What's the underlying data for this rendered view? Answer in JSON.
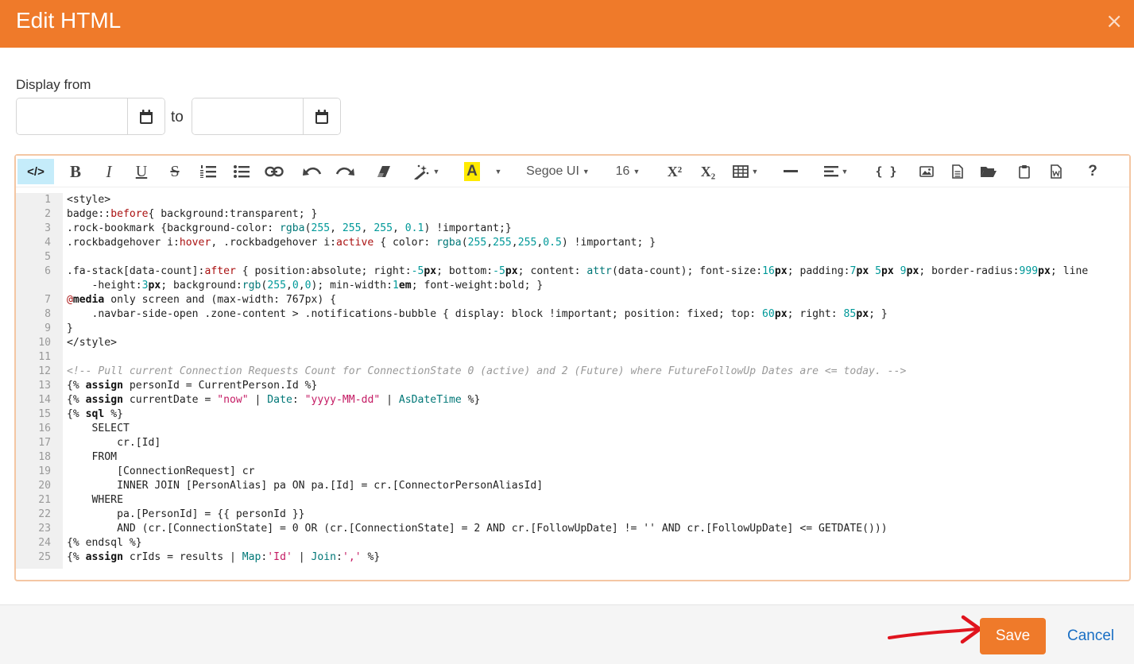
{
  "dialog": {
    "title": "Edit HTML",
    "close_glyph": "×"
  },
  "display_range": {
    "label": "Display from",
    "start_value": "",
    "to_label": "to",
    "end_value": ""
  },
  "toolbar": {
    "font_name": "Segoe UI",
    "font_size": "16",
    "code_view_glyph": "</>",
    "bold_glyph": "B",
    "italic_glyph": "I",
    "underline_glyph": "U",
    "strike_glyph": "S",
    "highlight_glyph": "A",
    "superscript_glyph": "X²",
    "subscript_glyph": "X₂",
    "braces_glyph": "{ }",
    "help_glyph": "?"
  },
  "code_lines": [
    {
      "n": "1"
    },
    {
      "n": "2"
    },
    {
      "n": "3"
    },
    {
      "n": "4"
    },
    {
      "n": "5"
    },
    {
      "n": "6"
    },
    {
      "n": ""
    },
    {
      "n": "7"
    },
    {
      "n": "8"
    },
    {
      "n": "9"
    },
    {
      "n": "10"
    },
    {
      "n": "11"
    },
    {
      "n": "12"
    },
    {
      "n": "13"
    },
    {
      "n": "14"
    },
    {
      "n": "15"
    },
    {
      "n": "16"
    },
    {
      "n": "17"
    },
    {
      "n": "18"
    },
    {
      "n": "19"
    },
    {
      "n": "20"
    },
    {
      "n": "21"
    },
    {
      "n": "22"
    },
    {
      "n": "23"
    },
    {
      "n": "24"
    },
    {
      "n": "25"
    }
  ],
  "code_segments": [
    [
      [
        "t",
        "<style>"
      ]
    ],
    [
      [
        "t",
        "badge::"
      ],
      [
        "k",
        "before"
      ],
      [
        "t",
        "{ background:transparent; }"
      ]
    ],
    [
      [
        "t",
        ".rock-bookmark {background-color: "
      ],
      [
        "f",
        "rgba"
      ],
      [
        "t",
        "("
      ],
      [
        "d",
        "255"
      ],
      [
        "t",
        ", "
      ],
      [
        "d",
        "255"
      ],
      [
        "t",
        ", "
      ],
      [
        "d",
        "255"
      ],
      [
        "t",
        ", "
      ],
      [
        "d",
        "0.1"
      ],
      [
        "t",
        ") !important;}"
      ]
    ],
    [
      [
        "t",
        ".rockbadgehover i:"
      ],
      [
        "k",
        "hover"
      ],
      [
        "t",
        ", .rockbadgehover i:"
      ],
      [
        "k",
        "active"
      ],
      [
        "t",
        " { color: "
      ],
      [
        "f",
        "rgba"
      ],
      [
        "t",
        "("
      ],
      [
        "d",
        "255"
      ],
      [
        "t",
        ","
      ],
      [
        "d",
        "255"
      ],
      [
        "t",
        ","
      ],
      [
        "d",
        "255"
      ],
      [
        "t",
        ","
      ],
      [
        "d",
        "0.5"
      ],
      [
        "t",
        ") !important; }"
      ]
    ],
    [
      [
        "t",
        ""
      ]
    ],
    [
      [
        "t",
        ".fa-stack[data-count]:"
      ],
      [
        "k",
        "after"
      ],
      [
        "t",
        " { position:absolute; right:"
      ],
      [
        "d",
        "-5"
      ],
      [
        "b",
        "px"
      ],
      [
        "t",
        "; bottom:"
      ],
      [
        "d",
        "-5"
      ],
      [
        "b",
        "px"
      ],
      [
        "t",
        "; content: "
      ],
      [
        "f",
        "attr"
      ],
      [
        "t",
        "(data-count); font-size:"
      ],
      [
        "d",
        "16"
      ],
      [
        "b",
        "px"
      ],
      [
        "t",
        "; padding:"
      ],
      [
        "d",
        "7"
      ],
      [
        "b",
        "px"
      ],
      [
        "t",
        " "
      ],
      [
        "d",
        "5"
      ],
      [
        "b",
        "px"
      ],
      [
        "t",
        " "
      ],
      [
        "d",
        "9"
      ],
      [
        "b",
        "px"
      ],
      [
        "t",
        "; border-radius:"
      ],
      [
        "d",
        "999"
      ],
      [
        "b",
        "px"
      ],
      [
        "t",
        "; line"
      ]
    ],
    [
      [
        "t",
        "    -height:"
      ],
      [
        "d",
        "3"
      ],
      [
        "b",
        "px"
      ],
      [
        "t",
        "; background:"
      ],
      [
        "f",
        "rgb"
      ],
      [
        "t",
        "("
      ],
      [
        "d",
        "255"
      ],
      [
        "t",
        ","
      ],
      [
        "d",
        "0"
      ],
      [
        "t",
        ","
      ],
      [
        "d",
        "0"
      ],
      [
        "t",
        "); min-width:"
      ],
      [
        "d",
        "1"
      ],
      [
        "b",
        "em"
      ],
      [
        "t",
        "; font-weight:bold; }"
      ]
    ],
    [
      [
        "k",
        "@"
      ],
      [
        "b",
        "media"
      ],
      [
        "t",
        " only screen and (max-width: 767px) {"
      ]
    ],
    [
      [
        "t",
        "    .navbar-side-open .zone-content > .notifications-bubble { display: block !important; position: fixed; top: "
      ],
      [
        "d",
        "60"
      ],
      [
        "b",
        "px"
      ],
      [
        "t",
        "; right: "
      ],
      [
        "d",
        "85"
      ],
      [
        "b",
        "px"
      ],
      [
        "t",
        "; }"
      ]
    ],
    [
      [
        "t",
        "}"
      ]
    ],
    [
      [
        "t",
        "</style>"
      ]
    ],
    [
      [
        "t",
        ""
      ]
    ],
    [
      [
        "c",
        "<!-- Pull current Connection Requests Count for ConnectionState 0 (active) and 2 (Future) where FutureFollowUp Dates are <= today. -->"
      ]
    ],
    [
      [
        "t",
        "{% "
      ],
      [
        "b",
        "assign"
      ],
      [
        "t",
        " personId = CurrentPerson.Id %}"
      ]
    ],
    [
      [
        "t",
        "{% "
      ],
      [
        "b",
        "assign"
      ],
      [
        "t",
        " currentDate = "
      ],
      [
        "s",
        "\"now\""
      ],
      [
        "t",
        " | "
      ],
      [
        "f",
        "Date"
      ],
      [
        "t",
        ": "
      ],
      [
        "s",
        "\"yyyy-MM-dd\""
      ],
      [
        "t",
        " | "
      ],
      [
        "f",
        "AsDateTime"
      ],
      [
        "t",
        " %}"
      ]
    ],
    [
      [
        "t",
        "{% "
      ],
      [
        "b",
        "sql"
      ],
      [
        "t",
        " %}"
      ]
    ],
    [
      [
        "t",
        "    SELECT"
      ]
    ],
    [
      [
        "t",
        "        cr.[Id]"
      ]
    ],
    [
      [
        "t",
        "    FROM"
      ]
    ],
    [
      [
        "t",
        "        [ConnectionRequest] cr"
      ]
    ],
    [
      [
        "t",
        "        INNER JOIN [PersonAlias] pa ON pa.[Id] = cr.[ConnectorPersonAliasId]"
      ]
    ],
    [
      [
        "t",
        "    WHERE"
      ]
    ],
    [
      [
        "t",
        "        pa.[PersonId] = {{ personId }}"
      ]
    ],
    [
      [
        "t",
        "        AND (cr.[ConnectionState] = 0 OR (cr.[ConnectionState] = 2 AND cr.[FollowUpDate] != '' AND cr.[FollowUpDate] <= GETDATE()))"
      ]
    ],
    [
      [
        "t",
        "{% endsql %}"
      ]
    ],
    [
      [
        "t",
        "{% "
      ],
      [
        "b",
        "assign"
      ],
      [
        "t",
        " crIds = results | "
      ],
      [
        "f",
        "Map"
      ],
      [
        "t",
        ":"
      ],
      [
        "s",
        "'Id'"
      ],
      [
        "t",
        " | "
      ],
      [
        "f",
        "Join"
      ],
      [
        "t",
        ":"
      ],
      [
        "s",
        "','"
      ],
      [
        "t",
        " %}"
      ]
    ]
  ],
  "footer": {
    "save_label": "Save",
    "cancel_label": "Cancel"
  },
  "colors": {
    "accent": "#ef7a2a",
    "link": "#1a6fc4",
    "annotation": "#e0141e"
  }
}
